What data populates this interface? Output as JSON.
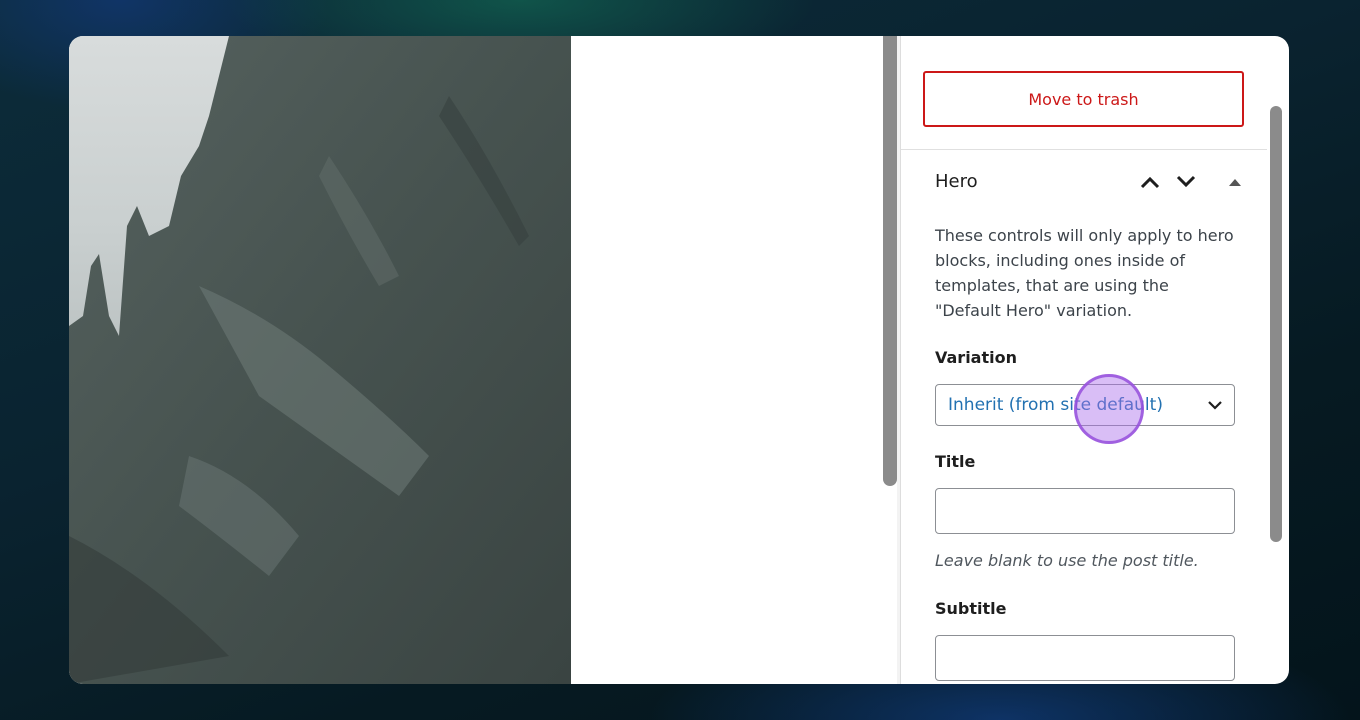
{
  "sidebar": {
    "trash_button_label": "Move to trash",
    "section": {
      "title": "Hero",
      "description": "These controls will only apply to hero blocks, including ones inside of templates, that are using the \"Default Hero\" variation."
    },
    "variation": {
      "label": "Variation",
      "selected": "Inherit (from site default)"
    },
    "title_field": {
      "label": "Title",
      "value": "",
      "hint": "Leave blank to use the post title."
    },
    "subtitle_field": {
      "label": "Subtitle",
      "value": ""
    }
  },
  "icons": {
    "move_up": "chevron-up-icon",
    "move_down": "chevron-down-icon",
    "collapse": "triangle-up-icon",
    "select_arrow": "chevron-down-icon"
  },
  "colors": {
    "danger": "#cc1818",
    "select_text": "#2271b1",
    "cursor_highlight": "#aa6eeb"
  }
}
